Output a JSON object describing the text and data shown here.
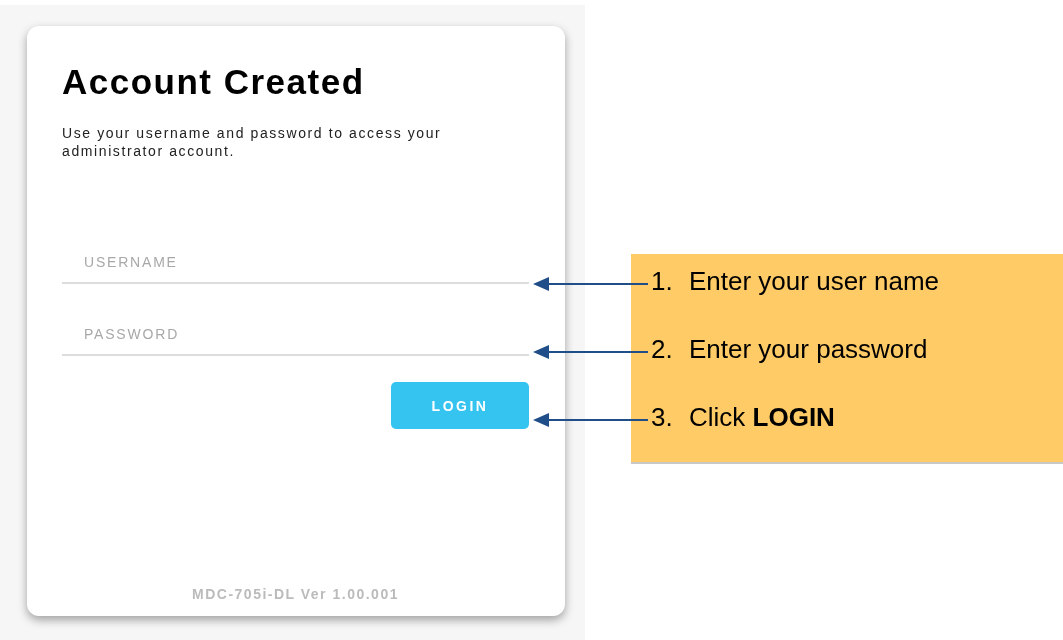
{
  "card": {
    "title": "Account Created",
    "message": "Use your username and password to access your administrator account.",
    "fields": [
      {
        "placeholder": "USERNAME"
      },
      {
        "placeholder": "PASSWORD"
      }
    ],
    "button": "LOGIN",
    "version": "MDC-705i-DL Ver 1.00.001"
  },
  "callout": {
    "steps": [
      {
        "number": "1.",
        "text": "Enter your user name"
      },
      {
        "number": "2.",
        "text": "Enter your password"
      },
      {
        "number": "3.",
        "text": "Click **LOGIN**"
      }
    ]
  }
}
